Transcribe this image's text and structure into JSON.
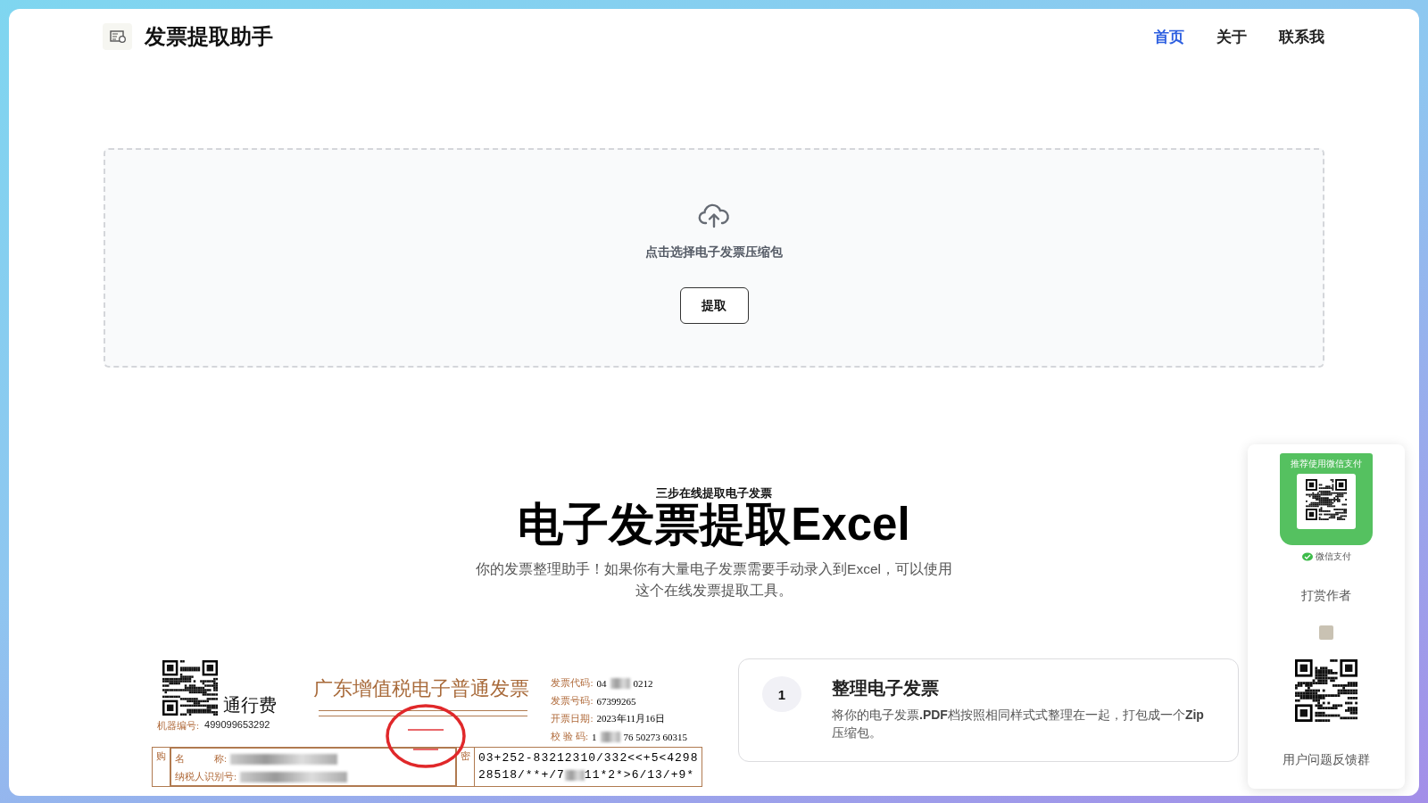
{
  "header": {
    "title": "发票提取助手",
    "nav": [
      {
        "label": "首页",
        "selected": true
      },
      {
        "label": "关于",
        "selected": false
      },
      {
        "label": "联系我",
        "selected": false
      }
    ]
  },
  "upload": {
    "hint": "点击选择电子发票压缩包",
    "button": "提取"
  },
  "hero": {
    "eyebrow": "三步在线提取电子发票",
    "title": "电子发票提取Excel",
    "description": "你的发票整理助手！如果你有大量电子发票需要手动录入到Excel，可以使用这个在线发票提取工具。"
  },
  "sample_invoice": {
    "title": "广东增值税电子普通发票",
    "category": "通行费",
    "machine_no": {
      "label": "机器编号:",
      "value": "499099653292"
    },
    "fields": [
      {
        "label": "发票代码:",
        "parts": [
          {
            "kind": "text",
            "text": "04"
          },
          {
            "kind": "blur"
          },
          {
            "kind": "text",
            "text": "0212"
          }
        ]
      },
      {
        "label": "发票号码:",
        "parts": [
          {
            "kind": "text",
            "text": "67399265"
          }
        ]
      },
      {
        "label": "开票日期:",
        "parts": [
          {
            "kind": "text",
            "text": "2023年11月16日"
          }
        ]
      },
      {
        "label": "校 验 码:",
        "parts": [
          {
            "kind": "text",
            "text": "1"
          },
          {
            "kind": "blur"
          },
          {
            "kind": "text",
            "text": "76 50273 60315"
          }
        ]
      }
    ],
    "buyer_label": "购",
    "buyer_rows": [
      {
        "label": "名　　　称:",
        "parts": [
          {
            "kind": "blur"
          }
        ]
      },
      {
        "label": "纳税人识别号:",
        "parts": [
          {
            "kind": "blur"
          }
        ]
      }
    ],
    "cipher_label": "密",
    "cipher_lines": [
      {
        "parts": [
          {
            "kind": "text",
            "text": "03+252-83212310/332<<+5<4298"
          }
        ]
      },
      {
        "parts": [
          {
            "kind": "text",
            "text": "28518/**+/7"
          },
          {
            "kind": "blur"
          },
          {
            "kind": "text",
            "text": "11*2*>6/13/+9*"
          }
        ]
      }
    ]
  },
  "steps": [
    {
      "number": "1",
      "title": "整理电子发票",
      "text": "将你的电子发票**.PDF**档按照相同样式式整理在一起，打包成一个**Zip**压缩包。"
    }
  ],
  "sidebar": {
    "pay_caption": "推荐使用微信支付",
    "pay_brand": "微信支付",
    "reward_label": "打赏作者",
    "group_label": "用户问题反馈群"
  }
}
